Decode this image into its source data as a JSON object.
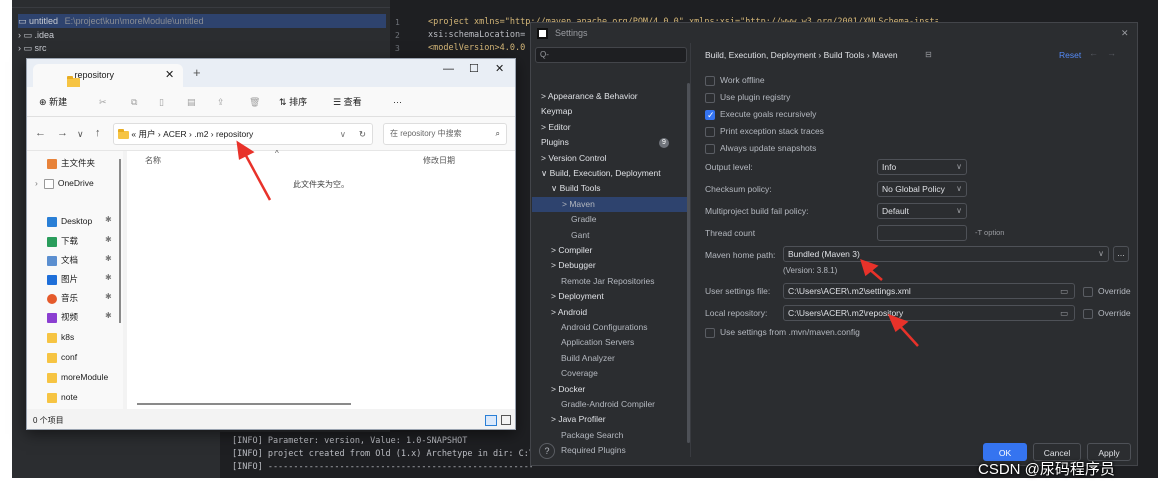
{
  "ide": {
    "project_tree": {
      "root_name": "untitled",
      "root_path": "E:\\project\\kun\\moreModule\\untitled",
      "items": [
        ".idea",
        "src"
      ]
    },
    "editor": {
      "line_numbers": [
        "1",
        "2",
        "3"
      ],
      "code_lines": [
        "<project xmlns=\"http://maven.apache.org/POM/4.0.0\" xmlns:xsi=\"http://www.w3.org/2001/XMLSchema-instance\"",
        "  xsi:schemaLocation=",
        "  <modelVersion>4.0.0"
      ]
    },
    "console": {
      "lines": [
        "[INFO] Parameter: version, Value: 1.0-SNAPSHOT",
        "[INFO] project created from Old (1.x) Archetype in dir: C:\\",
        "[INFO] ------------------------------------------------------------"
      ]
    }
  },
  "explorer": {
    "tab_title": "repository",
    "toolbar": {
      "new_label": "新建",
      "sort_label": "排序",
      "view_label": "查看",
      "more_label": "···"
    },
    "address": {
      "prefix": "«",
      "crumbs": [
        "用户",
        "ACER",
        ".m2",
        "repository"
      ]
    },
    "search_placeholder": "在 repository 中搜索",
    "nav": [
      {
        "label": "主文件夹",
        "pinned": false
      },
      {
        "label": "OneDrive",
        "pinned": false
      },
      {
        "label": "Desktop",
        "pinned": true
      },
      {
        "label": "下载",
        "pinned": true
      },
      {
        "label": "文档",
        "pinned": true
      },
      {
        "label": "图片",
        "pinned": true
      },
      {
        "label": "音乐",
        "pinned": true
      },
      {
        "label": "视频",
        "pinned": true
      },
      {
        "label": "k8s",
        "pinned": false
      },
      {
        "label": "conf",
        "pinned": false
      },
      {
        "label": "moreModule",
        "pinned": false
      },
      {
        "label": "note",
        "pinned": false
      }
    ],
    "columns": {
      "name": "名称",
      "modified": "修改日期"
    },
    "empty_text": "此文件夹为空。",
    "status": "0 个项目"
  },
  "settings": {
    "title": "Settings",
    "search_placeholder": "Q-",
    "breadcrumb": "Build, Execution, Deployment  ›  Build Tools  ›  Maven",
    "reset_label": "Reset",
    "tree": [
      {
        "label": "> Appearance & Behavior",
        "level": 0
      },
      {
        "label": "Keymap",
        "level": 0
      },
      {
        "label": "> Editor",
        "level": 0
      },
      {
        "label": "Plugins",
        "level": 0,
        "badge": "9"
      },
      {
        "label": "> Version Control",
        "level": 0
      },
      {
        "label": "∨ Build, Execution, Deployment",
        "level": 0
      },
      {
        "label": "∨ Build Tools",
        "level": 1
      },
      {
        "label": "> Maven",
        "level": 2,
        "selected": true
      },
      {
        "label": "Gradle",
        "level": 3
      },
      {
        "label": "Gant",
        "level": 3
      },
      {
        "label": "> Compiler",
        "level": 1
      },
      {
        "label": "> Debugger",
        "level": 1
      },
      {
        "label": "Remote Jar Repositories",
        "level": 2
      },
      {
        "label": "> Deployment",
        "level": 1
      },
      {
        "label": "> Android",
        "level": 1
      },
      {
        "label": "Android Configurations",
        "level": 2
      },
      {
        "label": "Application Servers",
        "level": 2
      },
      {
        "label": "Build Analyzer",
        "level": 2
      },
      {
        "label": "Coverage",
        "level": 2
      },
      {
        "label": "> Docker",
        "level": 1
      },
      {
        "label": "Gradle-Android Compiler",
        "level": 2
      },
      {
        "label": "> Java Profiler",
        "level": 1
      },
      {
        "label": "Package Search",
        "level": 2
      },
      {
        "label": "Required Plugins",
        "level": 2
      }
    ],
    "checkboxes": [
      {
        "label": "Work offline",
        "checked": false
      },
      {
        "label": "Use plugin registry",
        "checked": false
      },
      {
        "label": "Execute goals recursively",
        "checked": true
      },
      {
        "label": "Print exception stack traces",
        "checked": false
      },
      {
        "label": "Always update snapshots",
        "checked": false
      }
    ],
    "output_level": {
      "label": "Output level:",
      "value": "Info"
    },
    "checksum_policy": {
      "label": "Checksum policy:",
      "value": "No Global Policy"
    },
    "fail_policy": {
      "label": "Multiproject build fail policy:",
      "value": "Default"
    },
    "thread_count": {
      "label": "Thread count",
      "value": "",
      "hint": "-T option"
    },
    "maven_home": {
      "label": "Maven home path:",
      "value": "Bundled (Maven 3)",
      "version": "(Version: 3.8.1)"
    },
    "user_settings": {
      "label": "User settings file:",
      "value": "C:\\Users\\ACER\\.m2\\settings.xml",
      "override": "Override"
    },
    "local_repo": {
      "label": "Local repository:",
      "value": "C:\\Users\\ACER\\.m2\\repository",
      "override": "Override"
    },
    "mvn_config": {
      "label": "Use settings from .mvn/maven.config"
    },
    "buttons": {
      "ok": "OK",
      "cancel": "Cancel",
      "apply": "Apply",
      "help": "?"
    }
  },
  "watermark": "CSDN @尿码程序员",
  "colors": {
    "accent": "#3574f0",
    "selection": "#2e436e",
    "arrow": "#e8322a"
  }
}
